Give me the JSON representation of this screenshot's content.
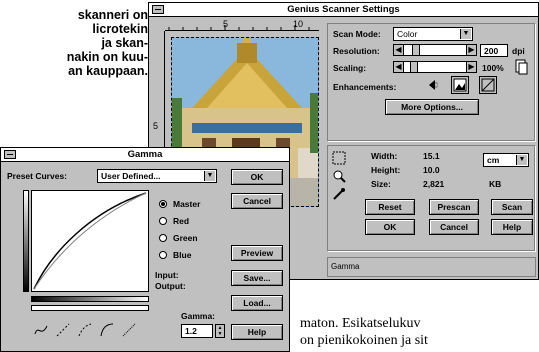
{
  "article": {
    "lines": [
      "skanneri on",
      "licrotekin",
      "ja skan-",
      "nakin on kuu-",
      "an kauppaan."
    ]
  },
  "bottom_text": "maton.   Esikatselukuv",
  "bottom_text2": "on pienikokoinen ja sit",
  "scanner": {
    "title": "Genius Scanner Settings",
    "ruler_labels": [
      "5",
      "10"
    ],
    "ruler_side_label": "5",
    "scan_mode_label": "Scan Mode:",
    "scan_mode_value": "Color",
    "resolution_label": "Resolution:",
    "resolution_value": "200",
    "resolution_unit": "dpi",
    "scaling_label": "Scaling:",
    "scaling_value": "100%",
    "enhancements_label": "Enhancements:",
    "more_options": "More Options...",
    "width_label": "Width:",
    "width_value": "15.1",
    "height_label": "Height:",
    "height_value": "10.0",
    "size_label": "Size:",
    "size_value": "2,821",
    "size_unit": "KB",
    "unit_value": "cm",
    "buttons": {
      "reset": "Reset",
      "prescan": "Prescan",
      "scan": "Scan",
      "ok": "OK",
      "cancel": "Cancel",
      "help": "Help"
    },
    "status": "Gamma"
  },
  "gamma": {
    "title": "Gamma",
    "preset_label": "Preset Curves:",
    "preset_value": "User Defined...",
    "channels": [
      "Master",
      "Red",
      "Green",
      "Blue"
    ],
    "selected_channel": "Master",
    "input_label": "Input:",
    "output_label": "Output:",
    "gamma_label": "Gamma:",
    "gamma_value": "1.2",
    "buttons": {
      "ok": "OK",
      "cancel": "Cancel",
      "preview": "Preview",
      "save": "Save...",
      "load": "Load...",
      "help": "Help"
    }
  },
  "colors": {
    "window_bg": "#c0c0c0",
    "title_bg": "#ffffff",
    "sky": "#7fb0d8",
    "temple_gold": "#c9a43a"
  }
}
